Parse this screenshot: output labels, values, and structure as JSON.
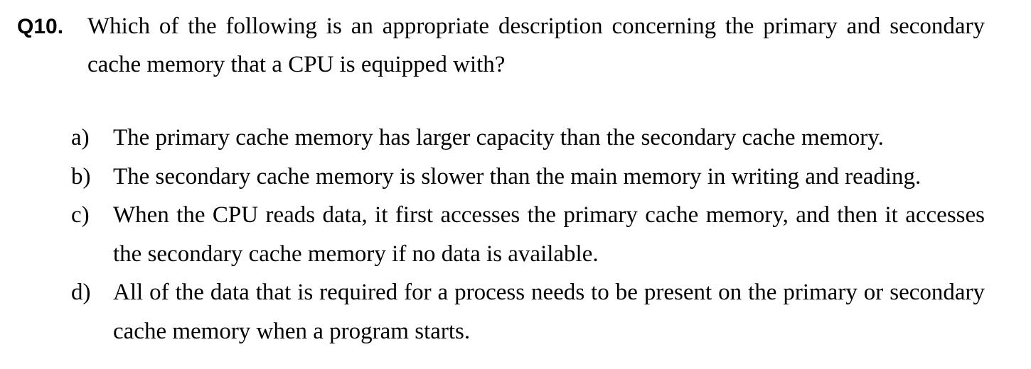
{
  "question": {
    "number": "Q10.",
    "text": "Which of the following is an appropriate description concerning the primary and secondary cache memory that a CPU is equipped with?"
  },
  "options": [
    {
      "letter": "a)",
      "text": "The primary cache memory has larger capacity than the secondary cache memory."
    },
    {
      "letter": "b)",
      "text": "The secondary cache memory is slower than the main memory in writing and reading."
    },
    {
      "letter": "c)",
      "text": "When the CPU reads data, it first accesses the primary cache memory, and then it accesses the secondary cache memory if no data is available."
    },
    {
      "letter": "d)",
      "text": "All of the data that is required for a process needs to be present on the primary or secondary cache memory when a program starts."
    }
  ]
}
